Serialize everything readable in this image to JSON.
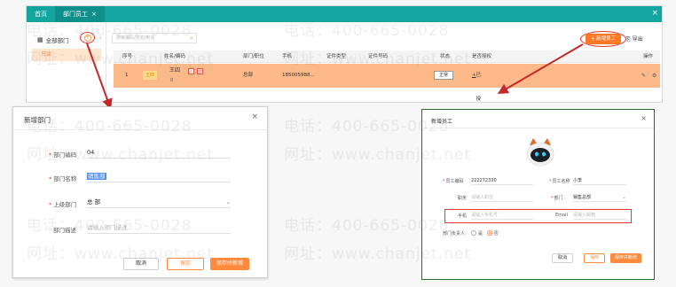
{
  "main": {
    "tabs": [
      {
        "label": "首页"
      },
      {
        "label": "部门员工"
      }
    ],
    "tab_close_glyph": "×",
    "window_close_glyph": "×",
    "departments": {
      "root_label": "全部部门",
      "item_label": "只读"
    },
    "search_placeholder": "搜索编码/姓名/电话",
    "toolbar": {
      "add_employee": "+ 新增员工",
      "export": "导出"
    },
    "table": {
      "columns": [
        "序号",
        "姓名/编码",
        "部门/职位",
        "手机",
        "证件类型",
        "证件号码",
        "状态",
        "是否授权",
        "操作"
      ],
      "row": {
        "index": "1",
        "name_tag": "王四",
        "name": "王四",
        "code": "0",
        "department": "总部",
        "phone": "185005988...",
        "status": "正常",
        "auth": "已授权"
      }
    }
  },
  "dialog_dept": {
    "title": "新增部门",
    "fields": {
      "code_label": "部门编码",
      "code_value": "04",
      "name_label": "部门名称",
      "name_value": "销售部",
      "parent_label": "上级部门",
      "parent_value": "总 部",
      "desc_label": "部门描述",
      "desc_placeholder": "请输入部门描述"
    },
    "buttons": {
      "cancel": "取消",
      "save": "保存",
      "save_new": "保存并新增"
    }
  },
  "dialog_emp": {
    "title": "新增员工",
    "fields": {
      "code_label": "员工编码",
      "code_value": "222272330",
      "name_label": "员工名称",
      "name_value": "小李",
      "position_label": "职务",
      "position_placeholder": "请输入职位",
      "dept_label": "部门",
      "dept_value": "销售总部",
      "phone_label": "手机",
      "phone_placeholder": "请输入手机号",
      "email_label": "Email",
      "email_placeholder": "请输入邮箱",
      "owner_label": "部门负责人",
      "yes": "是",
      "no": "否"
    },
    "buttons": {
      "cancel": "取消",
      "save": "保存",
      "save_new": "保存并新增"
    }
  },
  "watermark": {
    "phone": "电话：400-665-0028",
    "site": "网址：www.chanjet.net"
  },
  "colors": {
    "topbar": "#15a5a1",
    "accent": "#ff7a28",
    "highlight_row": "#fbb98a",
    "annotation": "#e53935"
  }
}
